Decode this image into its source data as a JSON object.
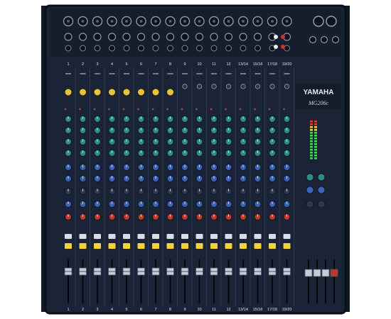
{
  "brand": {
    "name": "YAMAHA",
    "model": "MG206c"
  },
  "channel_numbers": [
    "1",
    "2",
    "3",
    "4",
    "5",
    "6",
    "7",
    "8",
    "9",
    "10",
    "11",
    "12",
    "13/14",
    "15/16",
    "17/18",
    "19/20"
  ],
  "colors": {
    "panel": "#1b2436",
    "panel_edge": "#0b0f18",
    "strip_line": "#3b4a66",
    "knob_teal": "#2f8f7e",
    "knob_blue": "#3a63b8",
    "knob_red": "#c0392b",
    "knob_yellow": "#e7c43a",
    "button_yellow": "#f2d13a",
    "meter_green": "#42d45a",
    "meter_yellow": "#e8d23c",
    "meter_red": "#e0392f"
  }
}
